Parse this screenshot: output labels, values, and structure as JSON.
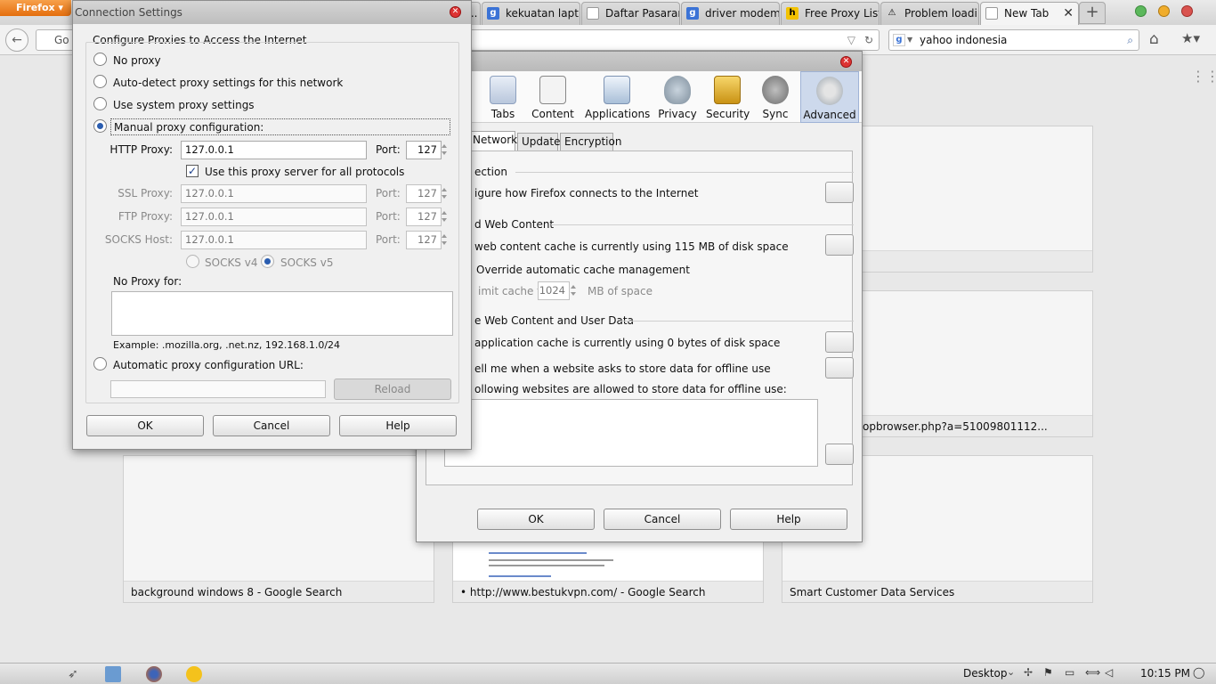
{
  "browser": {
    "menu_button": "Firefox",
    "tabs": [
      {
        "label": "...",
        "icon": "generic-page-icon"
      },
      {
        "label": "kekuatan lapt...",
        "icon": "google-icon"
      },
      {
        "label": "Daftar Pasaran...",
        "icon": "page-icon"
      },
      {
        "label": "driver modem ...",
        "icon": "google-icon"
      },
      {
        "label": "Free Proxy List ...",
        "icon": "h-icon"
      },
      {
        "label": "Problem loadi...",
        "icon": "warning-icon"
      },
      {
        "label": "New Tab",
        "icon": "page-icon"
      }
    ],
    "url_text": "Go t",
    "search_text": "yahoo indonesia"
  },
  "thumbnails": [
    {
      "label": ""
    },
    {
      "label": "artfren.com/popbrowser.php?a=51009801112..."
    },
    {
      "label": "background windows 8 - Google Search"
    },
    {
      "label": "• http://www.bestukvpn.com/ - Google Search"
    },
    {
      "label": "Smart Customer Data Services"
    }
  ],
  "options_dialog": {
    "categories": [
      {
        "label": "Tabs"
      },
      {
        "label": "Content"
      },
      {
        "label": "Applications"
      },
      {
        "label": "Privacy"
      },
      {
        "label": "Security"
      },
      {
        "label": "Sync"
      },
      {
        "label": "Advanced"
      }
    ],
    "subtabs": [
      "Network",
      "Update",
      "Encryption"
    ],
    "connection_heading": "ection",
    "connection_text": "igure how Firefox connects to the Internet",
    "cache_heading": "d Web Content",
    "cache_text": "web content cache is currently using 115 MB of disk space",
    "override_text": "Override automatic cache management",
    "limit_text": "imit cache to",
    "limit_value": "1024",
    "limit_unit": "MB of space",
    "offline_heading": "e Web Content and User Data",
    "appcache_text": "application cache is currently using 0 bytes of disk space",
    "tell_text": "ell me when a website asks to store data for offline use",
    "allowed_text": "ollowing websites are allowed to store data for offline use:",
    "ok": "OK",
    "cancel": "Cancel",
    "help": "Help"
  },
  "connection_dialog": {
    "title": "Connection Settings",
    "group_label": "Configure Proxies to Access the Internet",
    "no_proxy": "No proxy",
    "auto_detect": "Auto-detect proxy settings for this network",
    "use_system": "Use system proxy settings",
    "manual": "Manual proxy configuration:",
    "http_label": "HTTP Proxy:",
    "http_value": "127.0.0.1",
    "port_label": "Port:",
    "http_port": "127",
    "use_all": "Use this proxy server for all protocols",
    "ssl_label": "SSL Proxy:",
    "ssl_value": "127.0.0.1",
    "ssl_port": "127",
    "ftp_label": "FTP Proxy:",
    "ftp_value": "127.0.0.1",
    "ftp_port": "127",
    "socks_label": "SOCKS Host:",
    "socks_value": "127.0.0.1",
    "socks_port": "127",
    "socks_v4": "SOCKS v4",
    "socks_v5": "SOCKS v5",
    "no_proxy_for": "No Proxy for:",
    "no_proxy_value": "",
    "example": "Example: .mozilla.org, .net.nz, 192.168.1.0/24",
    "auto_url": "Automatic proxy configuration URL:",
    "auto_url_value": "",
    "reload": "Reload",
    "ok": "OK",
    "cancel": "Cancel",
    "help": "Help"
  },
  "taskbar": {
    "desktop": "Desktop",
    "time": "10:15 PM"
  }
}
